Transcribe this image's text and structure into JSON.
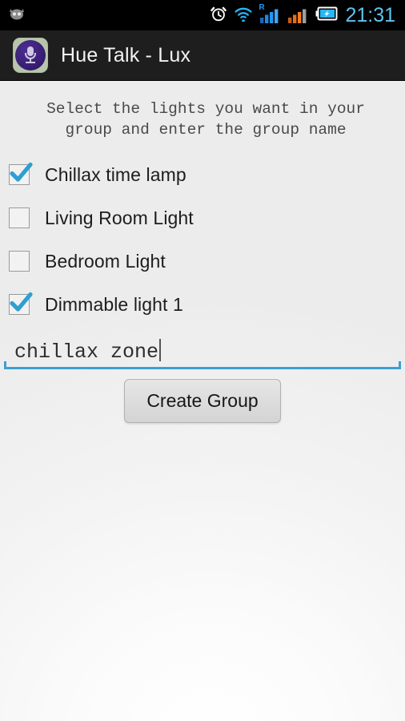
{
  "statusbar": {
    "time": "21:31",
    "icons": [
      {
        "name": "notification-robot-icon",
        "label": "notification"
      },
      {
        "name": "alarm-clock-icon",
        "label": "alarm"
      },
      {
        "name": "wifi-icon",
        "label": "wifi"
      },
      {
        "name": "cellular-signal-icon",
        "label": "signal"
      },
      {
        "name": "cellular-signal-secondary-icon",
        "label": "signal2"
      },
      {
        "name": "battery-charging-icon",
        "label": "battery"
      }
    ],
    "roaming_label": "R",
    "clock_color": "#5fc3f0",
    "background_color": "#000000"
  },
  "titlebar": {
    "app_title": "Hue Talk - Lux",
    "icon_name": "microphone-app-icon",
    "background_color": "#1e1e1e",
    "text_color": "#f2f2f2"
  },
  "main": {
    "instructions_line1": "Select the lights you want in your",
    "instructions_line2": "group and enter the group name",
    "lights": [
      {
        "label": "Chillax time lamp",
        "checked": true
      },
      {
        "label": "Living Room Light",
        "checked": false
      },
      {
        "label": "Bedroom Light",
        "checked": false
      },
      {
        "label": "Dimmable light 1",
        "checked": true
      }
    ],
    "group_name_input": {
      "value": "chillax zone",
      "placeholder": "",
      "underline_color": "#3d9fd4"
    },
    "create_button_label": "Create Group",
    "accent_color": "#3d9fd4",
    "checkbox_check_color": "#2f9fd0"
  }
}
